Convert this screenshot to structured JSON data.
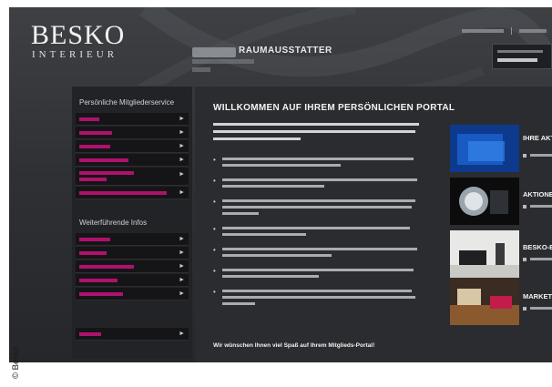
{
  "header": {
    "logo_main": "BESKO",
    "logo_sub": "INTERIEUR",
    "brand_name": "RAUMAUSSTATTER"
  },
  "sidebar": {
    "section1_title": "Persönliche Mitgliederservice",
    "section2_title": "Weiterführende Infos",
    "accent_color": "#b0116d"
  },
  "main": {
    "title": "WILLKOMMEN AUF IHREM PERSÖNLICHEN PORTAL",
    "closing": "Wir wünschen Ihnen viel Spaß auf Ihrem Mitglieds-Portal!"
  },
  "promos": [
    {
      "title": "IHRE AKTU... EINKAUFEN",
      "image": "blue-promo-image"
    },
    {
      "title": "AKTIONEN",
      "image": "glass-lamp-image"
    },
    {
      "title": "BESKO-EIG...",
      "image": "sofa-room-image"
    },
    {
      "title": "MARKETING",
      "image": "interior-room-image"
    }
  ],
  "copyright": "© Besko"
}
